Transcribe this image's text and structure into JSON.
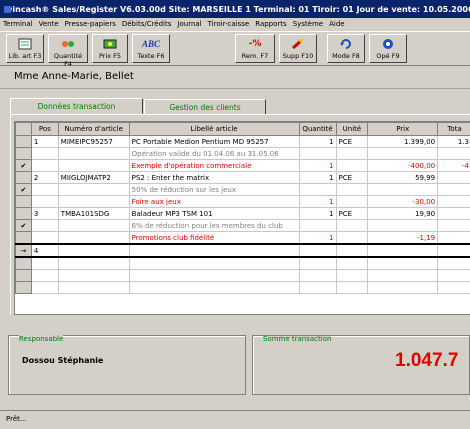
{
  "window": {
    "title": "wincash® Sales/Register V6.03.00d   Site: MARSEILLE 1   Terminal: 01   Tiroir: 01   Jour de vente: 10.05.2006"
  },
  "menu": [
    "Terminal",
    "Vente",
    "Presse-papiers",
    "Débits/Crédits",
    "Journal",
    "Tiroir-caisse",
    "Rapports",
    "Système",
    "Aide"
  ],
  "toolbar": {
    "buttons": [
      {
        "label": "Lib. art F3",
        "icon": "list-icon"
      },
      {
        "label": "Quantité F4",
        "icon": "quantity-icon"
      },
      {
        "label": "Prix F5",
        "icon": "price-icon"
      },
      {
        "label": "Texte F6",
        "icon": "text-icon",
        "glyph": "ABC"
      },
      {
        "label": "Rem. F7",
        "icon": "discount-icon",
        "glyph": "-%"
      },
      {
        "label": "Supp F10",
        "icon": "delete-icon"
      },
      {
        "label": "Mode F8",
        "icon": "mode-icon"
      },
      {
        "label": "Opé F9",
        "icon": "operation-icon"
      }
    ]
  },
  "customer": {
    "name": "Mme Anne-Marie, Bellet"
  },
  "tabs": [
    {
      "label": "Données transaction",
      "active": true
    },
    {
      "label": "Gestion des clients",
      "active": false
    }
  ],
  "table": {
    "headers": [
      "Pos",
      "Numéro d'article",
      "Libellé article",
      "Quantité",
      "Unité",
      "Prix",
      "Tota"
    ],
    "rows": [
      {
        "mark": "",
        "pos": "1",
        "article": "MIMEIPC95257",
        "label": "PC Portable Medion Pentium MD 95257",
        "qty": "1",
        "unit": "PCE",
        "price": "1.399,00",
        "total": "1.3",
        "style": ""
      },
      {
        "mark": "",
        "pos": "",
        "article": "",
        "label": "Opération valide du 01.04.06 au 31.05.06",
        "qty": "",
        "unit": "",
        "price": "",
        "total": "",
        "style": "grey"
      },
      {
        "mark": "✔",
        "pos": "",
        "article": "",
        "label": "Exemple d'opération commerciale",
        "qty": "1",
        "unit": "",
        "price": "-400,00",
        "total": "-4",
        "style": "red"
      },
      {
        "mark": "",
        "pos": "2",
        "article": "MIIGLOJMATP2",
        "label": "PS2 : Enter the matrix",
        "qty": "1",
        "unit": "PCE",
        "price": "59,99",
        "total": "",
        "style": ""
      },
      {
        "mark": "✔",
        "pos": "",
        "article": "",
        "label": "50% de réduction sur les jeux",
        "qty": "",
        "unit": "",
        "price": "",
        "total": "",
        "style": "grey"
      },
      {
        "mark": "",
        "pos": "",
        "article": "",
        "label": "Foire aux jeux",
        "qty": "1",
        "unit": "",
        "price": "-30,00",
        "total": "",
        "style": "red"
      },
      {
        "mark": "",
        "pos": "3",
        "article": "TMBA101SDG",
        "label": "Baladeur MP3 TSM 101",
        "qty": "1",
        "unit": "PCE",
        "price": "19,90",
        "total": "",
        "style": ""
      },
      {
        "mark": "✔",
        "pos": "",
        "article": "",
        "label": "6% de réduction pour les membres du club",
        "qty": "",
        "unit": "",
        "price": "",
        "total": "",
        "style": "grey"
      },
      {
        "mark": "",
        "pos": "",
        "article": "",
        "label": "Promotions club fidélité",
        "qty": "1",
        "unit": "",
        "price": "-1,19",
        "total": "",
        "style": "red"
      },
      {
        "mark": "→",
        "pos": "4",
        "article": "",
        "label": "",
        "qty": "",
        "unit": "",
        "price": "",
        "total": "",
        "style": "new"
      },
      {
        "mark": "",
        "pos": "",
        "article": "",
        "label": "",
        "qty": "",
        "unit": "",
        "price": "",
        "total": "",
        "style": ""
      },
      {
        "mark": "",
        "pos": "",
        "article": "",
        "label": "",
        "qty": "",
        "unit": "",
        "price": "",
        "total": "",
        "style": ""
      },
      {
        "mark": "",
        "pos": "",
        "article": "",
        "label": "",
        "qty": "",
        "unit": "",
        "price": "",
        "total": "",
        "style": ""
      }
    ]
  },
  "responsible": {
    "label": "Responsable",
    "name": "Dossou Stéphanie"
  },
  "sum": {
    "label": "Somme transaction",
    "value": "1.047.7"
  },
  "status": {
    "text": "Prêt..."
  },
  "colors": {
    "accent_green": "#007a00",
    "red": "#e00000",
    "title_bar": "#0a246a"
  }
}
